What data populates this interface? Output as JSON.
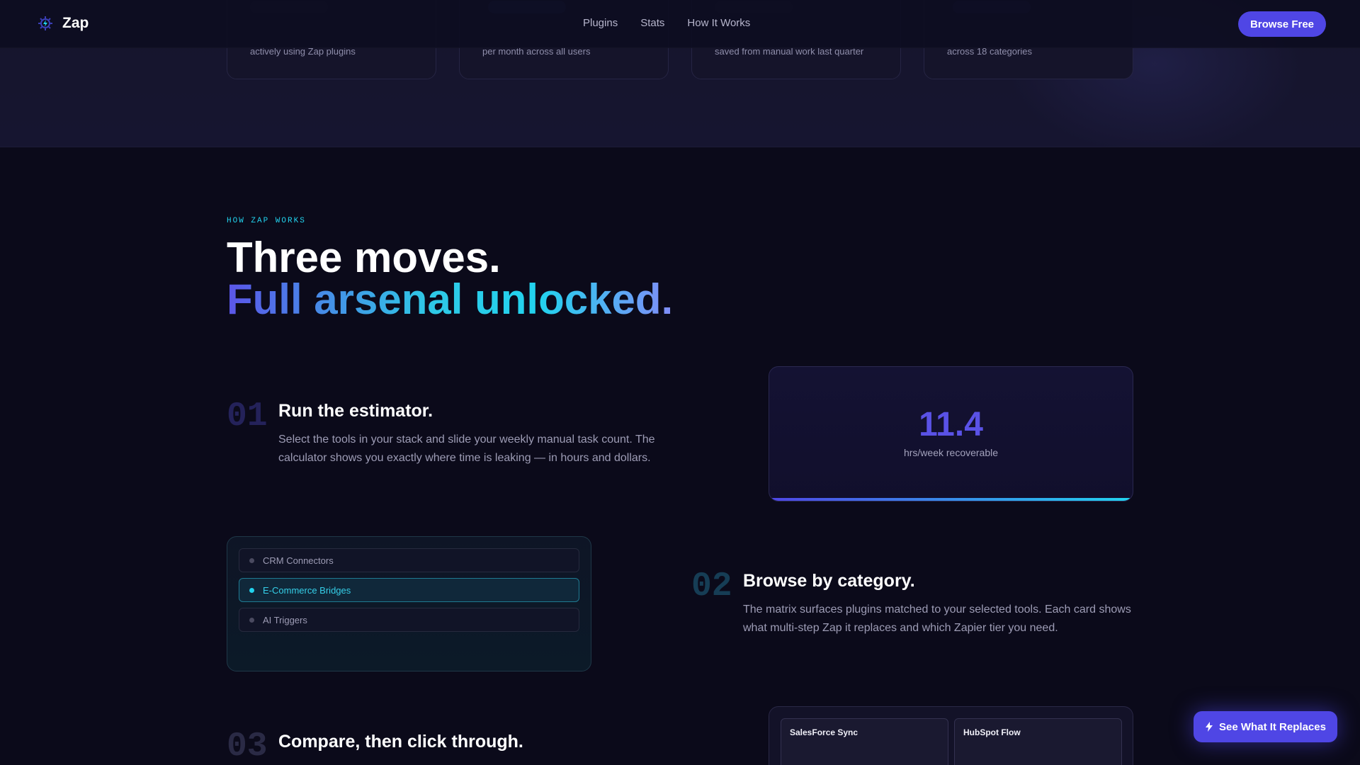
{
  "nav": {
    "brand": "Zap",
    "logo_icon": "bolt-gear-icon",
    "links": [
      "Plugins",
      "Stats",
      "How It Works"
    ],
    "cta": "Browse Free"
  },
  "stats": [
    {
      "sub": "actively using Zap plugins"
    },
    {
      "sub": "per month across all users"
    },
    {
      "sub": "saved from manual work last quarter"
    },
    {
      "sub": "across 18 categories"
    }
  ],
  "how": {
    "eyebrow": "HOW ZAP WORKS",
    "title_line1": "Three moves.",
    "title_line2": "Full arsenal unlocked."
  },
  "steps": [
    {
      "num": "01",
      "title": "Run the estimator.",
      "desc": "Select the tools in your stack and slide your weekly manual task count. The calculator shows you exactly where time is leaking — in hours and dollars."
    },
    {
      "num": "02",
      "title": "Browse by category.",
      "desc": "The matrix surfaces plugins matched to your selected tools. Each card shows what multi-step Zap it replaces and which Zapier tier you need."
    },
    {
      "num": "03",
      "title": "Compare, then click through."
    }
  ],
  "estimator": {
    "value": "11.4",
    "label": "hrs/week recoverable"
  },
  "categories": [
    {
      "label": "CRM Connectors",
      "active": false
    },
    {
      "label": "E-Commerce Bridges",
      "active": true
    },
    {
      "label": "AI Triggers",
      "active": false
    }
  ],
  "compare": {
    "tiles": [
      "SalesForce Sync",
      "HubSpot Flow"
    ]
  },
  "float_cta": {
    "label": "See What It Replaces",
    "icon": "bolt-icon"
  },
  "colors": {
    "accent": "#4f46e5",
    "cyan": "#22d3ee",
    "background": "#0b0a1a"
  }
}
